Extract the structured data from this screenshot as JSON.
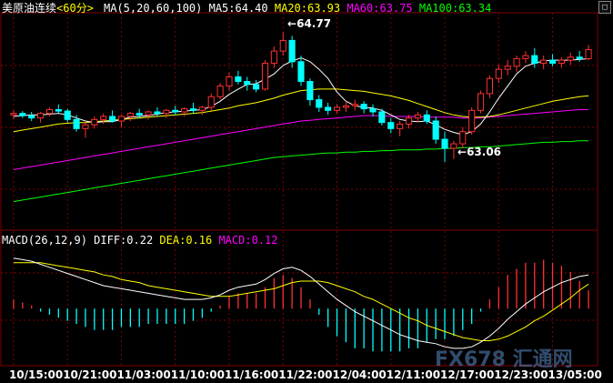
{
  "header": {
    "symbol": "美原油连续",
    "period": "<60分>",
    "ma_label": "MA(5,20,60,100)",
    "ma5": "MA5:64.40",
    "ma20": "MA20:63.93",
    "ma60": "MA60:63.75",
    "ma100": "MA100:63.34"
  },
  "macd_header": {
    "label": "MACD(26,12,9)",
    "diff": "DIFF:0.22",
    "dea": "DEA:0.16",
    "macd": "MACD:0.12"
  },
  "colors": {
    "ma5": "#ffffff",
    "ma20": "#ffff00",
    "ma60": "#ff00ff",
    "ma100": "#00ff00",
    "up": "#ff3030",
    "down": "#00ffff",
    "grid": "#800000"
  },
  "watermark": "FX678 汇通网",
  "icon": "window-restore-icon",
  "annotations": {
    "high": "64.77",
    "low": "63.06"
  },
  "chart_data": [
    {
      "type": "candlestick",
      "title": "美原油连续<60分>",
      "x": [
        "10/15:00",
        "10/21:00",
        "11/03:00",
        "11/10:00",
        "11/16:00",
        "11/22:00",
        "12/04:00",
        "12/11:00",
        "12/17:00",
        "12/23:00",
        "13/05:00"
      ],
      "ylim": [
        62.2,
        65.0
      ],
      "ohlc": [
        [
          63.68,
          63.74,
          63.62,
          63.7
        ],
        [
          63.7,
          63.73,
          63.64,
          63.67
        ],
        [
          63.67,
          63.72,
          63.6,
          63.64
        ],
        [
          63.64,
          63.72,
          63.58,
          63.7
        ],
        [
          63.7,
          63.78,
          63.66,
          63.75
        ],
        [
          63.75,
          63.82,
          63.7,
          63.73
        ],
        [
          63.73,
          63.76,
          63.58,
          63.62
        ],
        [
          63.62,
          63.68,
          63.46,
          63.5
        ],
        [
          63.5,
          63.58,
          63.38,
          63.55
        ],
        [
          63.55,
          63.66,
          63.5,
          63.62
        ],
        [
          63.62,
          63.7,
          63.56,
          63.66
        ],
        [
          63.66,
          63.74,
          63.58,
          63.6
        ],
        [
          63.6,
          63.68,
          63.52,
          63.66
        ],
        [
          63.66,
          63.72,
          63.6,
          63.7
        ],
        [
          63.7,
          63.76,
          63.64,
          63.68
        ],
        [
          63.68,
          63.74,
          63.62,
          63.72
        ],
        [
          63.72,
          63.78,
          63.66,
          63.7
        ],
        [
          63.7,
          63.76,
          63.64,
          63.74
        ],
        [
          63.74,
          63.8,
          63.68,
          63.72
        ],
        [
          63.72,
          63.78,
          63.66,
          63.76
        ],
        [
          63.76,
          63.84,
          63.7,
          63.74
        ],
        [
          63.74,
          63.8,
          63.68,
          63.78
        ],
        [
          63.78,
          63.96,
          63.74,
          63.92
        ],
        [
          63.92,
          64.1,
          63.88,
          64.06
        ],
        [
          64.06,
          64.24,
          64.0,
          64.18
        ],
        [
          64.18,
          64.26,
          64.08,
          64.12
        ],
        [
          64.12,
          64.18,
          64.0,
          64.08
        ],
        [
          64.08,
          64.14,
          63.98,
          64.02
        ],
        [
          64.02,
          64.4,
          64.0,
          64.36
        ],
        [
          64.36,
          64.58,
          64.3,
          64.52
        ],
        [
          64.52,
          64.77,
          64.46,
          64.66
        ],
        [
          64.66,
          64.72,
          64.3,
          64.38
        ],
        [
          64.38,
          64.46,
          64.06,
          64.12
        ],
        [
          64.12,
          64.16,
          63.8,
          63.88
        ],
        [
          63.88,
          63.94,
          63.72,
          63.78
        ],
        [
          63.78,
          63.84,
          63.68,
          63.74
        ],
        [
          63.74,
          63.82,
          63.7,
          63.78
        ],
        [
          63.78,
          63.86,
          63.72,
          63.8
        ],
        [
          63.8,
          63.88,
          63.74,
          63.82
        ],
        [
          63.82,
          63.86,
          63.7,
          63.76
        ],
        [
          63.76,
          63.82,
          63.66,
          63.72
        ],
        [
          63.72,
          63.76,
          63.54,
          63.58
        ],
        [
          63.58,
          63.64,
          63.44,
          63.5
        ],
        [
          63.5,
          63.6,
          63.4,
          63.56
        ],
        [
          63.56,
          63.68,
          63.5,
          63.64
        ],
        [
          63.64,
          63.72,
          63.58,
          63.68
        ],
        [
          63.68,
          63.74,
          63.56,
          63.6
        ],
        [
          63.6,
          63.66,
          63.3,
          63.36
        ],
        [
          63.36,
          63.46,
          63.06,
          63.24
        ],
        [
          63.24,
          63.34,
          63.1,
          63.3
        ],
        [
          63.3,
          63.52,
          63.24,
          63.46
        ],
        [
          63.46,
          63.78,
          63.42,
          63.74
        ],
        [
          63.74,
          64.0,
          63.7,
          63.96
        ],
        [
          63.96,
          64.2,
          63.9,
          64.16
        ],
        [
          64.16,
          64.34,
          64.1,
          64.28
        ],
        [
          64.28,
          64.4,
          64.2,
          64.32
        ],
        [
          64.32,
          64.46,
          64.24,
          64.42
        ],
        [
          64.42,
          64.52,
          64.36,
          64.46
        ],
        [
          64.46,
          64.56,
          64.3,
          64.36
        ],
        [
          64.36,
          64.46,
          64.28,
          64.4
        ],
        [
          64.4,
          64.48,
          64.32,
          64.36
        ],
        [
          64.36,
          64.44,
          64.3,
          64.4
        ],
        [
          64.4,
          64.5,
          64.34,
          64.44
        ],
        [
          64.44,
          64.52,
          64.38,
          64.42
        ],
        [
          64.42,
          64.6,
          64.4,
          64.54
        ]
      ],
      "series": [
        {
          "name": "MA5",
          "values": [
            63.66,
            63.67,
            63.68,
            63.68,
            63.69,
            63.7,
            63.68,
            63.64,
            63.6,
            63.58,
            63.59,
            63.59,
            63.62,
            63.65,
            63.66,
            63.67,
            63.69,
            63.71,
            63.72,
            63.73,
            63.74,
            63.75,
            63.79,
            63.86,
            63.95,
            64.02,
            64.08,
            64.09,
            64.15,
            64.22,
            64.33,
            64.39,
            64.43,
            64.38,
            64.28,
            64.16,
            63.98,
            63.86,
            63.8,
            63.78,
            63.77,
            63.74,
            63.68,
            63.62,
            63.6,
            63.59,
            63.6,
            63.55,
            63.49,
            63.45,
            63.42,
            63.46,
            63.56,
            63.72,
            63.9,
            64.06,
            64.22,
            64.32,
            64.36,
            64.39,
            64.4,
            64.4,
            64.4,
            64.41,
            64.42
          ]
        },
        {
          "name": "MA20",
          "values": [
            63.46,
            63.48,
            63.5,
            63.52,
            63.54,
            63.56,
            63.57,
            63.58,
            63.58,
            63.59,
            63.6,
            63.61,
            63.62,
            63.63,
            63.64,
            63.65,
            63.66,
            63.67,
            63.68,
            63.69,
            63.7,
            63.71,
            63.73,
            63.75,
            63.77,
            63.8,
            63.82,
            63.84,
            63.87,
            63.9,
            63.94,
            63.97,
            64.0,
            64.01,
            64.02,
            64.02,
            64.02,
            64.01,
            64.0,
            63.99,
            63.97,
            63.95,
            63.93,
            63.9,
            63.87,
            63.83,
            63.79,
            63.75,
            63.71,
            63.68,
            63.66,
            63.65,
            63.65,
            63.66,
            63.68,
            63.71,
            63.74,
            63.77,
            63.8,
            63.83,
            63.86,
            63.88,
            63.9,
            63.92,
            63.93
          ]
        },
        {
          "name": "MA60",
          "values": [
            62.96,
            62.98,
            63.0,
            63.02,
            63.04,
            63.06,
            63.08,
            63.1,
            63.12,
            63.14,
            63.16,
            63.18,
            63.2,
            63.22,
            63.24,
            63.26,
            63.28,
            63.3,
            63.32,
            63.34,
            63.36,
            63.38,
            63.4,
            63.42,
            63.44,
            63.46,
            63.48,
            63.5,
            63.52,
            63.54,
            63.56,
            63.58,
            63.6,
            63.61,
            63.62,
            63.63,
            63.64,
            63.65,
            63.66,
            63.67,
            63.67,
            63.67,
            63.66,
            63.66,
            63.66,
            63.66,
            63.65,
            63.65,
            63.65,
            63.65,
            63.64,
            63.64,
            63.64,
            63.65,
            63.66,
            63.67,
            63.68,
            63.69,
            63.7,
            63.71,
            63.72,
            63.73,
            63.74,
            63.75,
            63.75
          ]
        },
        {
          "name": "MA100",
          "values": [
            62.54,
            62.56,
            62.58,
            62.6,
            62.62,
            62.64,
            62.66,
            62.68,
            62.7,
            62.72,
            62.74,
            62.76,
            62.78,
            62.8,
            62.82,
            62.84,
            62.86,
            62.88,
            62.9,
            62.92,
            62.94,
            62.96,
            62.98,
            63.0,
            63.02,
            63.04,
            63.06,
            63.08,
            63.1,
            63.12,
            63.13,
            63.14,
            63.15,
            63.16,
            63.17,
            63.18,
            63.18,
            63.19,
            63.19,
            63.2,
            63.2,
            63.21,
            63.21,
            63.22,
            63.22,
            63.22,
            63.23,
            63.23,
            63.24,
            63.24,
            63.25,
            63.25,
            63.26,
            63.26,
            63.27,
            63.28,
            63.29,
            63.3,
            63.31,
            63.32,
            63.32,
            63.33,
            63.33,
            63.34,
            63.34
          ]
        }
      ]
    },
    {
      "type": "macd",
      "title": "MACD(26,12,9)",
      "ylim": [
        -0.35,
        0.4
      ],
      "diff": [
        0.33,
        0.32,
        0.31,
        0.29,
        0.27,
        0.25,
        0.23,
        0.21,
        0.19,
        0.17,
        0.15,
        0.14,
        0.13,
        0.12,
        0.11,
        0.1,
        0.09,
        0.08,
        0.07,
        0.06,
        0.06,
        0.06,
        0.07,
        0.09,
        0.12,
        0.14,
        0.15,
        0.16,
        0.19,
        0.23,
        0.26,
        0.27,
        0.25,
        0.21,
        0.16,
        0.11,
        0.06,
        0.02,
        -0.02,
        -0.05,
        -0.08,
        -0.11,
        -0.14,
        -0.17,
        -0.19,
        -0.21,
        -0.22,
        -0.23,
        -0.25,
        -0.26,
        -0.26,
        -0.25,
        -0.22,
        -0.18,
        -0.13,
        -0.07,
        -0.02,
        0.03,
        0.07,
        0.11,
        0.14,
        0.17,
        0.19,
        0.21,
        0.22
      ],
      "dea": [
        0.3,
        0.3,
        0.3,
        0.3,
        0.29,
        0.28,
        0.27,
        0.26,
        0.25,
        0.24,
        0.22,
        0.21,
        0.19,
        0.18,
        0.17,
        0.15,
        0.14,
        0.13,
        0.12,
        0.11,
        0.1,
        0.09,
        0.08,
        0.08,
        0.08,
        0.09,
        0.1,
        0.11,
        0.12,
        0.13,
        0.15,
        0.17,
        0.18,
        0.18,
        0.18,
        0.17,
        0.15,
        0.13,
        0.11,
        0.08,
        0.06,
        0.03,
        0.0,
        -0.03,
        -0.06,
        -0.08,
        -0.11,
        -0.13,
        -0.15,
        -0.17,
        -0.19,
        -0.2,
        -0.21,
        -0.21,
        -0.2,
        -0.18,
        -0.15,
        -0.12,
        -0.08,
        -0.05,
        -0.01,
        0.03,
        0.07,
        0.12,
        0.16
      ],
      "macd": [
        0.06,
        0.04,
        0.02,
        -0.02,
        -0.04,
        -0.06,
        -0.08,
        -0.1,
        -0.12,
        -0.14,
        -0.14,
        -0.14,
        -0.12,
        -0.12,
        -0.12,
        -0.1,
        -0.1,
        -0.1,
        -0.1,
        -0.1,
        -0.08,
        -0.06,
        -0.02,
        0.02,
        0.08,
        0.1,
        0.1,
        0.1,
        0.14,
        0.2,
        0.22,
        0.2,
        0.14,
        0.06,
        -0.04,
        -0.12,
        -0.18,
        -0.22,
        -0.26,
        -0.26,
        -0.28,
        -0.28,
        -0.28,
        -0.28,
        -0.26,
        -0.26,
        -0.22,
        -0.2,
        -0.2,
        -0.18,
        -0.14,
        -0.1,
        -0.02,
        0.06,
        0.14,
        0.22,
        0.26,
        0.3,
        0.3,
        0.32,
        0.3,
        0.28,
        0.24,
        0.18,
        0.12
      ]
    }
  ]
}
